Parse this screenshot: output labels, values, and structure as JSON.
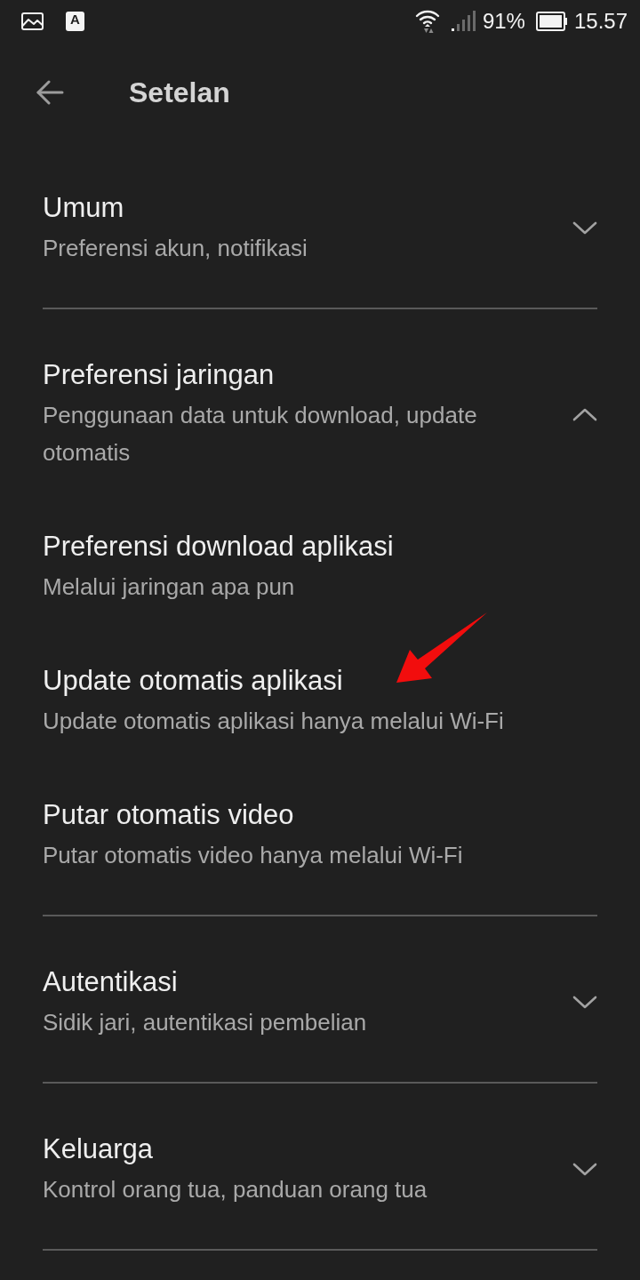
{
  "status_bar": {
    "app_icon_letter": "A",
    "battery_percent": "91%",
    "time": "15.57"
  },
  "app_bar": {
    "title": "Setelan"
  },
  "sections": [
    {
      "title": "Umum",
      "subtitle": "Preferensi akun, notifikasi",
      "expanded": false
    },
    {
      "title": "Preferensi jaringan",
      "subtitle": "Penggunaan data untuk download, update otomatis",
      "expanded": true,
      "children": [
        {
          "title": "Preferensi download aplikasi",
          "subtitle": "Melalui jaringan apa pun"
        },
        {
          "title": "Update otomatis aplikasi",
          "subtitle": "Update otomatis aplikasi hanya melalui Wi-Fi"
        },
        {
          "title": "Putar otomatis video",
          "subtitle": "Putar otomatis video hanya melalui Wi-Fi"
        }
      ]
    },
    {
      "title": "Autentikasi",
      "subtitle": "Sidik jari, autentikasi pembelian",
      "expanded": false
    },
    {
      "title": "Keluarga",
      "subtitle": "Kontrol orang tua, panduan orang tua",
      "expanded": false
    }
  ]
}
